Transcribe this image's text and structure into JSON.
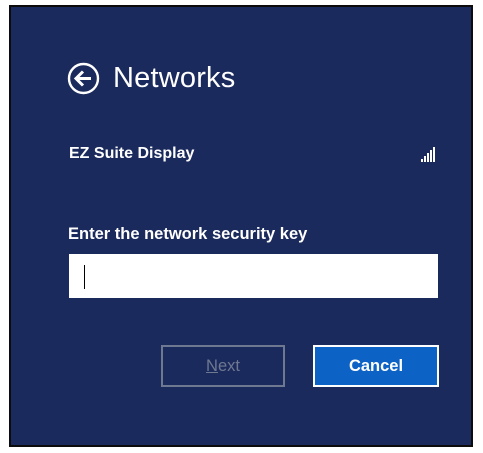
{
  "header": {
    "back_icon": "back-arrow-circle-icon",
    "title": "Networks"
  },
  "network": {
    "name": "EZ Suite Display",
    "signal_icon": "signal-strength-icon",
    "signal_bars_active": 5,
    "signal_bars_total": 5
  },
  "security_key": {
    "label": "Enter the network security key",
    "value": "",
    "placeholder": ""
  },
  "buttons": {
    "next_label": "Next",
    "next_mnemonic": "N",
    "next_rest": "ext",
    "next_enabled": false,
    "cancel_label": "Cancel"
  },
  "colors": {
    "background": "#1b2a5c",
    "accent": "#0d62c6",
    "disabled": "#6f7891"
  }
}
